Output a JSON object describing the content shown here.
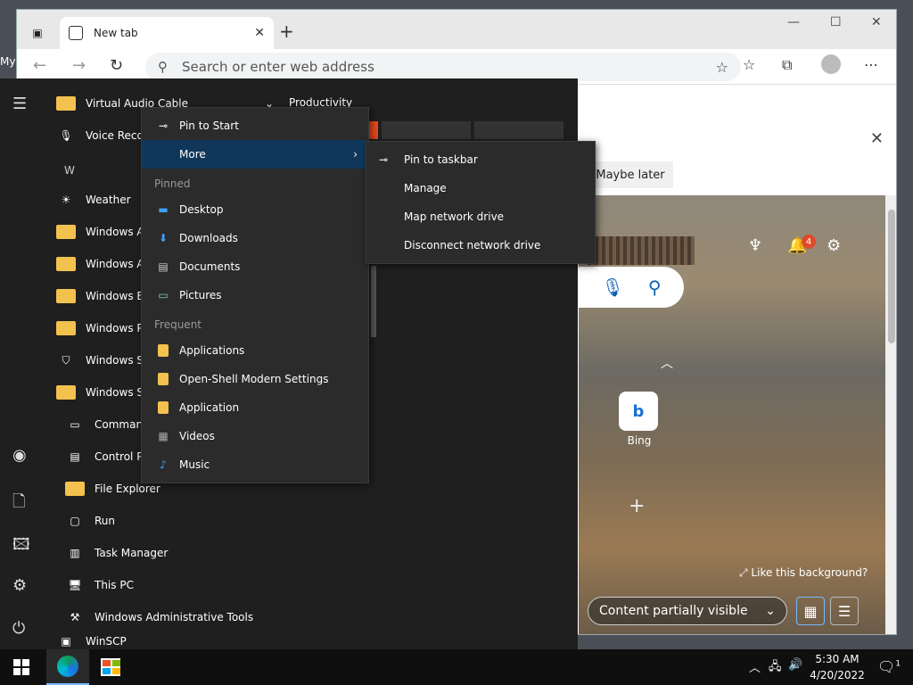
{
  "browser": {
    "tab_title": "New tab",
    "omnibox_placeholder": "Search or enter web address",
    "maybe_later": "Maybe later",
    "partial_left_text": "My",
    "notification_count": "4",
    "bing_label": "Bing",
    "like_background": "Like this background?",
    "content_visibility": "Content partially visible"
  },
  "start_menu": {
    "productivity_label": "Productivity",
    "letter_w": "W",
    "apps": [
      {
        "label": "Virtual Audio Cable",
        "icon": "folder-icon"
      },
      {
        "label": "Voice Recorder",
        "icon": "microphone-icon"
      },
      {
        "label": "Weather",
        "icon": "sun-icon"
      },
      {
        "label": "Windows Accessories",
        "icon": "folder-icon"
      },
      {
        "label": "Windows Administrative",
        "icon": "folder-icon"
      },
      {
        "label": "Windows Ease of Access",
        "icon": "folder-icon"
      },
      {
        "label": "Windows PowerShell",
        "icon": "folder-icon"
      },
      {
        "label": "Windows Security",
        "icon": "shield-icon"
      },
      {
        "label": "Windows System",
        "icon": "folder-icon"
      },
      {
        "label": "Command Prompt",
        "icon": "console-icon"
      },
      {
        "label": "Control Panel",
        "icon": "control-panel-icon"
      },
      {
        "label": "File Explorer",
        "icon": "folder-icon"
      },
      {
        "label": "Run",
        "icon": "run-icon"
      },
      {
        "label": "Task Manager",
        "icon": "task-manager-icon"
      },
      {
        "label": "This PC",
        "icon": "computer-icon"
      },
      {
        "label": "Windows Administrative Tools",
        "icon": "admin-tools-icon"
      },
      {
        "label": "WinSCP",
        "icon": "winscp-icon"
      }
    ]
  },
  "context_menu": {
    "pin_to_start": "Pin to Start",
    "more": "More",
    "pinned_header": "Pinned",
    "pinned": [
      "Desktop",
      "Downloads",
      "Documents",
      "Pictures"
    ],
    "frequent_header": "Frequent",
    "frequent": [
      "Applications",
      "Open-Shell Modern Settings",
      "Application",
      "Videos",
      "Music"
    ]
  },
  "submenu": {
    "items": [
      "Pin to taskbar",
      "Manage",
      "Map network drive",
      "Disconnect network drive"
    ]
  },
  "taskbar": {
    "time": "5:30 AM",
    "date": "4/20/2022",
    "notification_count": "1"
  },
  "colors": {
    "accent": "#10375a",
    "folder": "#f2c14e",
    "start_bg": "#1f1f1f",
    "menu_bg": "#2b2b2b"
  }
}
